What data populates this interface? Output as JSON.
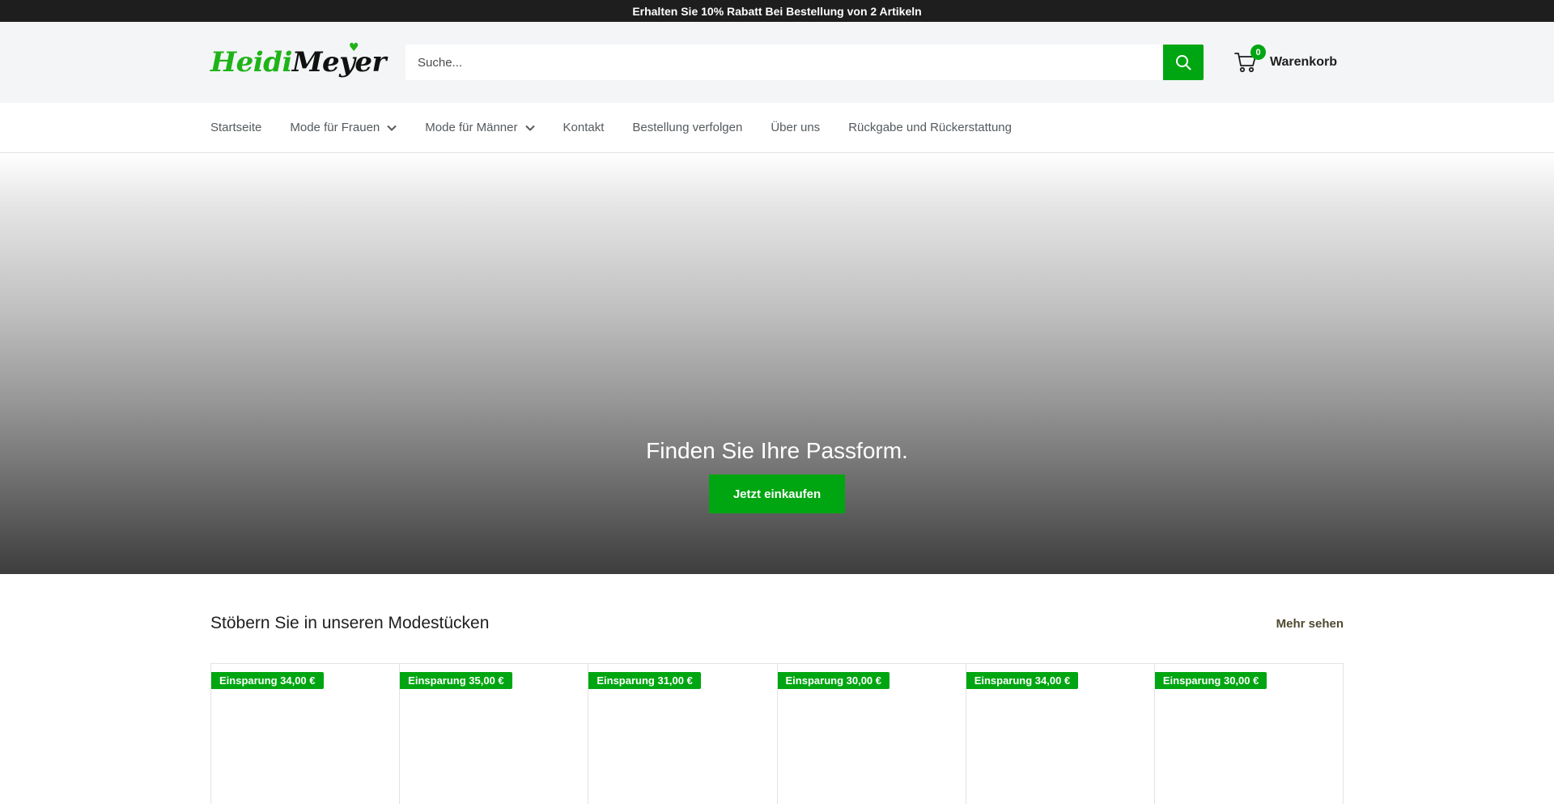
{
  "announcement": {
    "text": "Erhalten Sie 10% Rabatt Bei Bestellung von 2 Artikeln"
  },
  "header": {
    "logo_part1": "Heidi",
    "logo_part2": "Meyer",
    "search_placeholder": "Suche...",
    "search_icon": "search-icon",
    "cart_icon": "cart-icon",
    "cart_count": "0",
    "cart_label": "Warenkorb"
  },
  "nav": {
    "items": [
      {
        "label": "Startseite",
        "dropdown": false
      },
      {
        "label": "Mode für Frauen",
        "dropdown": true
      },
      {
        "label": "Mode für Männer",
        "dropdown": true
      },
      {
        "label": "Kontakt",
        "dropdown": false
      },
      {
        "label": "Bestellung verfolgen",
        "dropdown": false
      },
      {
        "label": "Über uns",
        "dropdown": false
      },
      {
        "label": "Rückgabe und Rückerstattung",
        "dropdown": false
      }
    ]
  },
  "hero": {
    "title": "Finden Sie Ihre Passform.",
    "button_label": "Jetzt einkaufen"
  },
  "collection": {
    "title": "Stöbern Sie in unseren Modestücken",
    "more_label": "Mehr sehen",
    "products": [
      {
        "badge": "Einsparung 34,00 €"
      },
      {
        "badge": "Einsparung 35,00 €"
      },
      {
        "badge": "Einsparung 31,00 €"
      },
      {
        "badge": "Einsparung 30,00 €"
      },
      {
        "badge": "Einsparung 34,00 €"
      },
      {
        "badge": "Einsparung 30,00 €"
      }
    ]
  },
  "colors": {
    "accent": "#00a611",
    "announcement_bg": "#1e1e1e",
    "header_bg": "#f3f5f6"
  }
}
